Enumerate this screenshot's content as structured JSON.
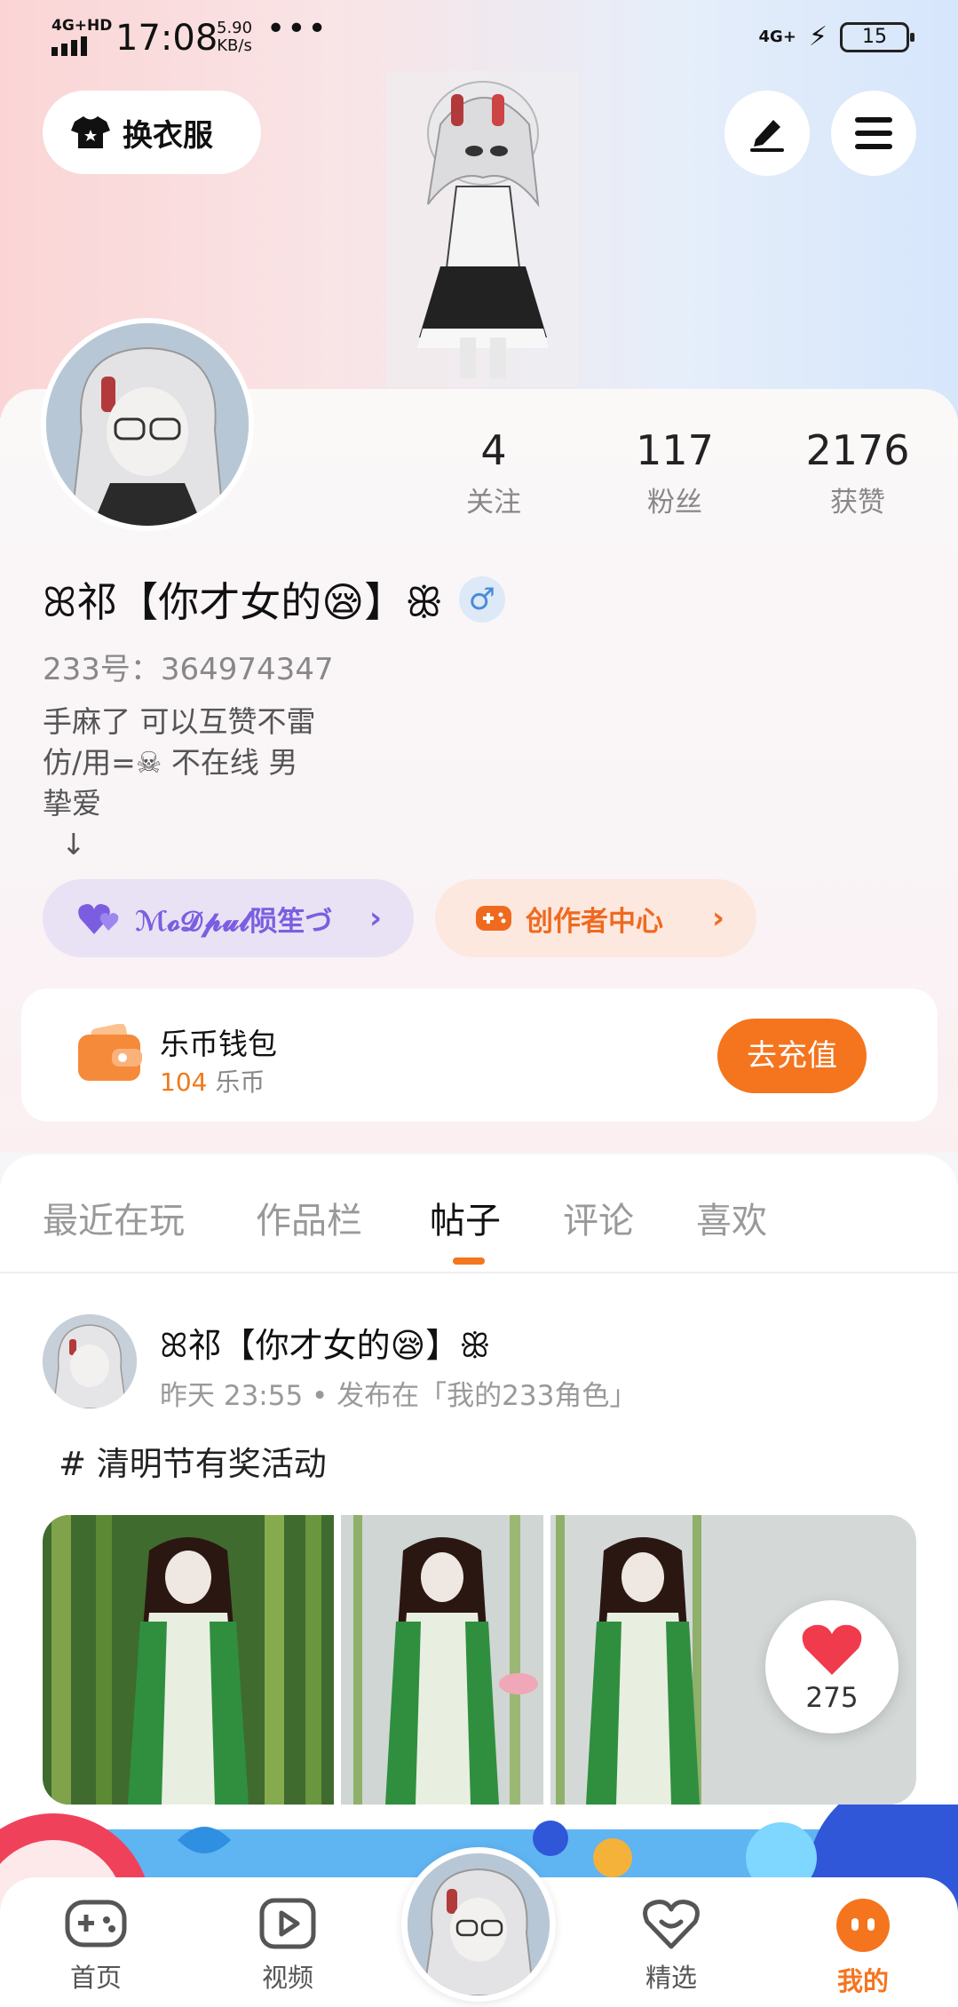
{
  "status_bar": {
    "network": "4G+HD",
    "time": "17:08",
    "speed_value": "5.90",
    "speed_unit": "KB/s",
    "more": "•••",
    "network_right": "4G+",
    "battery": "15"
  },
  "header": {
    "outfit_label": "换衣服",
    "edit_icon": "pen-icon",
    "menu_icon": "menu-icon"
  },
  "profile": {
    "stats": [
      {
        "value": "4",
        "label": "关注"
      },
      {
        "value": "117",
        "label": "粉丝"
      },
      {
        "value": "2176",
        "label": "获赞"
      }
    ],
    "nickname": "ꕤ祁【你才女的😪】ꕥ",
    "gender_symbol": "♂",
    "uid": "233号：364974347",
    "bio": "手麻了 可以互赞不雷\n仿/用=☠ 不在线 男\n挚爱\n  ↓",
    "partner_label": "ℳ𝓸𝓓𝓹𝓾𝓵陨笙づ",
    "creator_label": "创作者中心"
  },
  "wallet": {
    "title": "乐币钱包",
    "amount": "104",
    "unit": "乐币",
    "recharge_label": "去充值"
  },
  "tabs": [
    {
      "label": "最近在玩",
      "active": false
    },
    {
      "label": "作品栏",
      "active": false
    },
    {
      "label": "帖子",
      "active": true
    },
    {
      "label": "评论",
      "active": false
    },
    {
      "label": "喜欢",
      "active": false
    }
  ],
  "post": {
    "author": "ꕤ祁【你才女的😪】ꕥ",
    "meta": "昨天 23:55 • 发布在「我的233角色」",
    "tag": "# 清明节有奖活动",
    "likes": "275"
  },
  "bottom_nav": [
    {
      "label": "首页",
      "icon": "gamepad-icon",
      "active": false
    },
    {
      "label": "视频",
      "icon": "video-icon",
      "active": false
    },
    {
      "label": "精选",
      "icon": "heart-icon",
      "active": false
    },
    {
      "label": "我的",
      "icon": "face-icon",
      "active": true
    }
  ],
  "colors": {
    "accent": "#f5741e",
    "purple": "#7b5ee0",
    "gender_blue": "#4c8bd8"
  }
}
